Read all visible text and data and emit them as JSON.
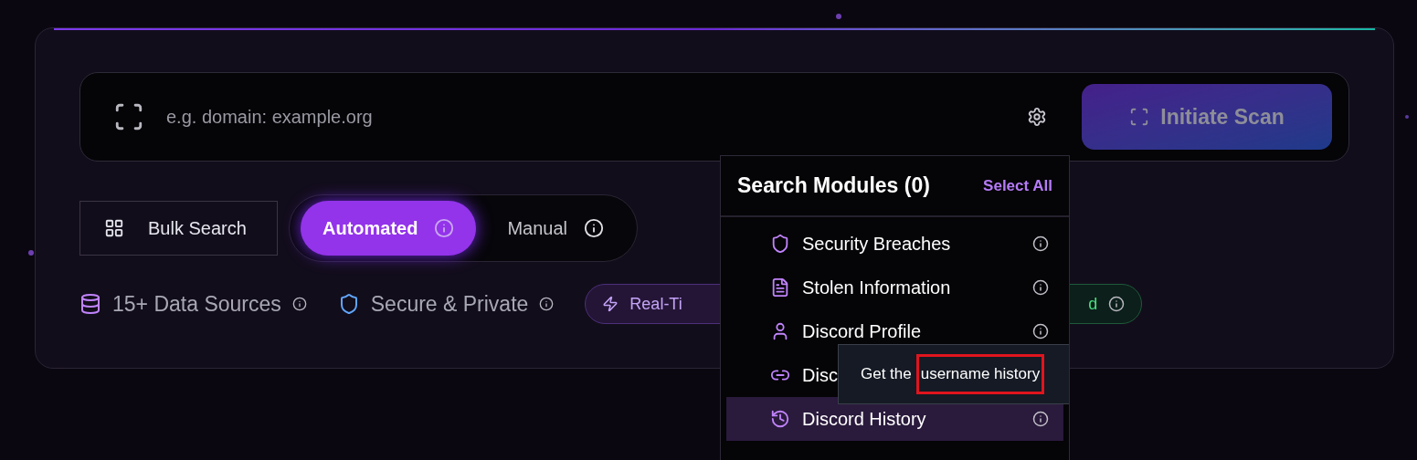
{
  "search": {
    "placeholder": "e.g. domain: example.org",
    "scan_button": {
      "label": "Initiate Scan",
      "disabled": true
    }
  },
  "bulk_button": {
    "label": "Bulk Search"
  },
  "modes": [
    {
      "label": "Automated",
      "selected": true
    },
    {
      "label": "Manual",
      "selected": false
    }
  ],
  "features": [
    {
      "kind": "database",
      "label": "15+ Data Sources"
    },
    {
      "kind": "shield",
      "label": "Secure & Private"
    }
  ],
  "badges": [
    {
      "kind": "bolt",
      "label": "Real-Ti",
      "color": "#c4a3f7"
    },
    {
      "kind": "info",
      "label": "d",
      "color": "#4ade80"
    }
  ],
  "modules_menu": {
    "title": "Search Modules (0)",
    "select_all": "Select All",
    "items": [
      {
        "kind": "shield",
        "label": "Security Breaches",
        "hovered": false,
        "info_button": true
      },
      {
        "kind": "document",
        "label": "Stolen Information",
        "hovered": false,
        "info_button": true
      },
      {
        "kind": "user",
        "label": "Discord Profile",
        "hovered": false,
        "info_button": true
      },
      {
        "kind": "link",
        "label": "Disc",
        "hovered": false,
        "info_button": false
      },
      {
        "kind": "history",
        "label": "Discord History",
        "hovered": true,
        "info_button": true
      }
    ],
    "tooltip": {
      "parts": [
        {
          "text": "Get the",
          "highlighted": false
        },
        {
          "text": "username history",
          "highlighted": true
        }
      ]
    }
  }
}
